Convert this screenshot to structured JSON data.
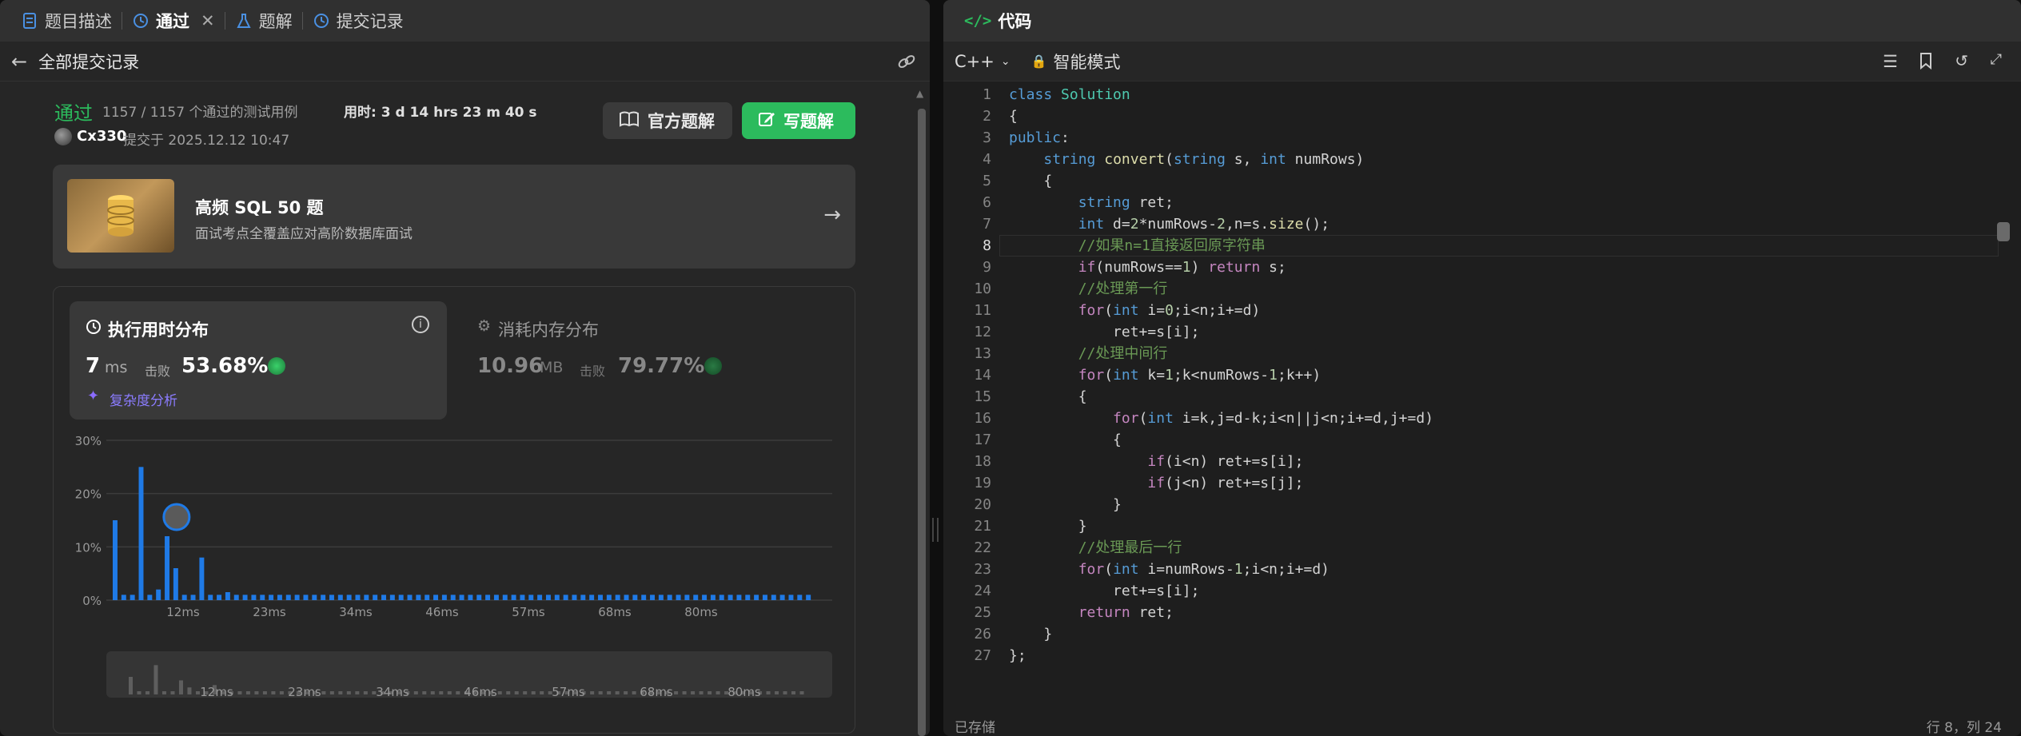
{
  "left_tabs": [
    {
      "label": "题目描述",
      "icon": "document-icon"
    },
    {
      "label": "通过",
      "icon": "history-icon"
    },
    {
      "label": "题解",
      "icon": "flask-icon"
    },
    {
      "label": "提交记录",
      "icon": "history-icon"
    }
  ],
  "subheader": {
    "back_label": "全部提交记录"
  },
  "submission": {
    "status": "通过",
    "tests": "1157 / 1157 个通过的测试用例",
    "time_label": "用时: 3 d 14 hrs 23 m 40 s",
    "user": "Cx330",
    "submitted": "提交于 2025.12.12 10:47"
  },
  "buttons": {
    "official": "官方题解",
    "write": "写题解"
  },
  "banner": {
    "title": "高频 SQL 50 题",
    "subtitle": "面试考点全覆盖应对高阶数据库面试"
  },
  "runtime": {
    "title": "执行用时分布",
    "value": "7",
    "unit": "ms",
    "beat_label": "击败",
    "beat": "53.68%",
    "complexity": "复杂度分析"
  },
  "memory": {
    "title": "消耗内存分布",
    "value": "10.96",
    "unit": "MB",
    "beat_label": "击败",
    "beat": "79.77%"
  },
  "chart_data": {
    "type": "bar",
    "ylabels": [
      "30%",
      "20%",
      "10%",
      "0%"
    ],
    "xlabels": [
      "12ms",
      "23ms",
      "34ms",
      "46ms",
      "57ms",
      "68ms",
      "80ms"
    ],
    "ylim": [
      0,
      30
    ],
    "values": [
      15,
      1,
      1,
      25,
      1,
      2,
      12,
      6,
      1,
      1,
      8,
      1,
      1,
      1.5,
      1,
      1,
      1,
      1,
      1,
      1,
      1,
      1,
      1,
      1,
      1,
      1,
      1,
      1,
      1,
      1,
      1,
      1,
      1,
      1,
      1,
      1,
      1,
      1,
      1,
      1,
      1,
      1,
      1,
      1,
      1,
      1,
      1,
      1,
      1,
      1,
      1,
      1,
      1,
      1,
      1,
      1,
      1,
      1,
      1,
      1,
      1,
      1,
      1,
      1,
      1,
      1,
      1,
      1,
      1,
      1,
      1,
      1,
      1,
      1,
      1,
      1,
      1,
      1,
      1,
      1,
      1
    ],
    "highlight_index": 7
  },
  "right": {
    "title": "代码",
    "language": "C++",
    "mode": "智能模式",
    "status_left": "已存储",
    "status_right": "行 8，列 24"
  },
  "code_lines": [
    "class Solution",
    "{",
    "public:",
    "    string convert(string s, int numRows)",
    "    {",
    "        string ret;",
    "        int d=2*numRows-2,n=s.size();",
    "        //如果n=1直接返回原字符串",
    "        if(numRows==1) return s;",
    "        //处理第一行",
    "        for(int i=0;i<n;i+=d)",
    "            ret+=s[i];",
    "        //处理中间行",
    "        for(int k=1;k<numRows-1;k++)",
    "        {",
    "            for(int i=k,j=d-k;i<n||j<n;i+=d,j+=d)",
    "            {",
    "                if(i<n) ret+=s[i];",
    "                if(j<n) ret+=s[j];",
    "            }",
    "        }",
    "        //处理最后一行",
    "        for(int i=numRows-1;i<n;i+=d)",
    "            ret+=s[i];",
    "        return ret;",
    "    }",
    "};"
  ]
}
